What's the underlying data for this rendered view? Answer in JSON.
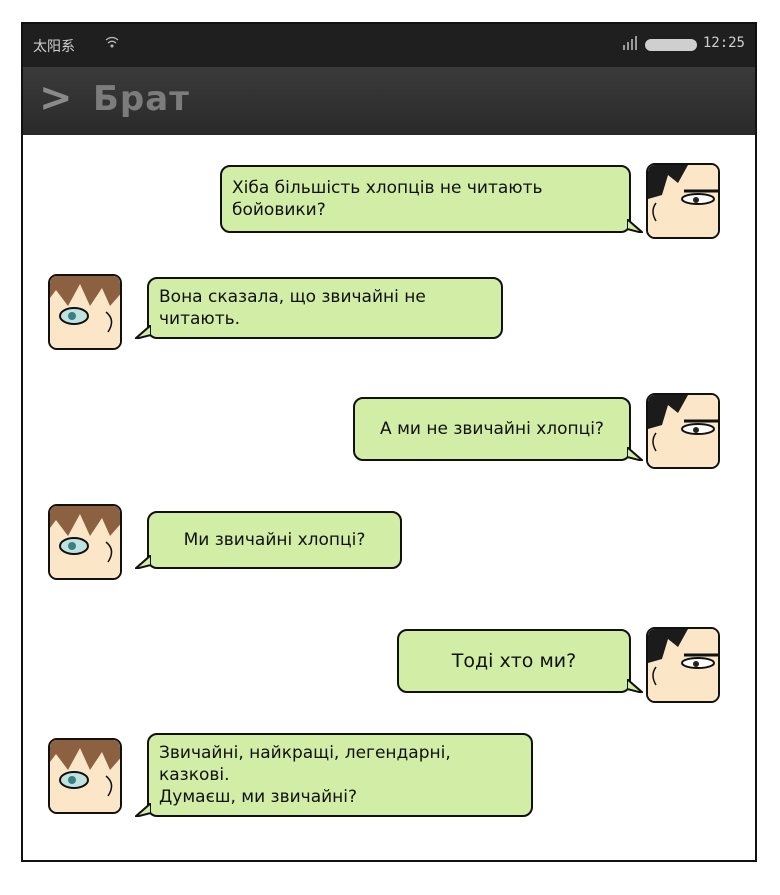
{
  "status_bar": {
    "carrier": "太阳系",
    "time": "12:25",
    "wifi_icon": "wifi-icon",
    "signal_icon": "signal-bars-icon",
    "battery_icon": "battery-icon"
  },
  "header": {
    "back_label": ">",
    "title": "Брат"
  },
  "colors": {
    "bubble": "#d2eda5",
    "header": "#2f2f2f",
    "status_bar": "#1f1f1f"
  },
  "messages": [
    {
      "side": "right",
      "speaker": "dark-haired",
      "text": "Хіба більшість хлопців не читають бойовики?"
    },
    {
      "side": "left",
      "speaker": "brown-haired",
      "text": "Вона сказала, що звичайні не читають."
    },
    {
      "side": "right",
      "speaker": "dark-haired",
      "text": "А ми не звичайні хлопці?"
    },
    {
      "side": "left",
      "speaker": "brown-haired",
      "text": "Ми звичайні хлопці?"
    },
    {
      "side": "right",
      "speaker": "dark-haired",
      "text": "Тоді хто ми?"
    },
    {
      "side": "left",
      "speaker": "brown-haired",
      "text": "Звичайні, найкращі, легендарні, казкові.\nДумаєш, ми звичайні?"
    }
  ]
}
